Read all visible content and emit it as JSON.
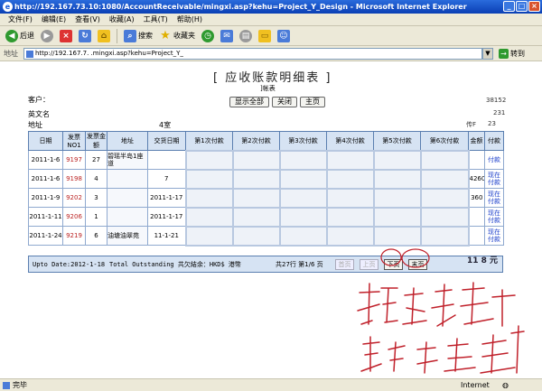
{
  "window": {
    "title": "http://192.167.73.10:1080/AccountReceivable/mingxi.asp?kehu=Project_Y_Design - Microsoft Internet Explorer",
    "controls": [
      "_",
      "□",
      "×"
    ]
  },
  "menu": [
    "文件(F)",
    "编辑(E)",
    "查看(V)",
    "收藏(A)",
    "工具(T)",
    "帮助(H)"
  ],
  "toolbar": {
    "back": "后退",
    "search": "搜索",
    "favorites": "收藏夹"
  },
  "address": {
    "label": "地址",
    "url": "http://192.167.7.                    .mingxi.asp?kehu=Project_Y_",
    "go": "转到"
  },
  "page": {
    "title": "[ 应收账款明细表 ]",
    "subtitle": "]帐表",
    "buttons": [
      "显示全部",
      "关闭",
      "主页"
    ],
    "customer_label": "客户：",
    "english_name_label": "英文名",
    "address_label": "地址",
    "address_tail": "4室",
    "right_val_1": "38152",
    "right_val_2": "231",
    "right_label_3": "传F",
    "right_val_3": "23"
  },
  "table": {
    "headers": [
      "日期",
      "发票NO1",
      "发票金额",
      "地址",
      "交货日期",
      "第1次付款",
      "第2次付款",
      "第3次付款",
      "第4次付款",
      "第5次付款",
      "第6次付款",
      "金额",
      "付款"
    ],
    "rows": [
      {
        "date": "2011-1-6",
        "inv": "9197",
        "amt": "27",
        "addr": "碧瑶半岛1座 道",
        "delivery": "",
        "amount": "",
        "pay": "付款"
      },
      {
        "date": "2011-1-6",
        "inv": "9198",
        "amt": "4",
        "addr": "",
        "delivery": "7",
        "amount": "4260",
        "pay": "现在 付款"
      },
      {
        "date": "2011-1-9",
        "inv": "9202",
        "amt": "3",
        "addr": "",
        "delivery": "2011-1-17",
        "amount": "360",
        "pay": "现在 付款"
      },
      {
        "date": "2011-1-11",
        "inv": "9206",
        "amt": "1",
        "addr": "",
        "delivery": "2011-1-17",
        "amount": "",
        "pay": "现在 付款"
      },
      {
        "date": "2011-1-24",
        "inv": "9219",
        "amt": "6",
        "addr": "油塘油翠苑",
        "delivery": "11-1-21",
        "amount": "",
        "pay": "现在 付款"
      }
    ]
  },
  "footer": {
    "upto": "Upto Date:2012-1-18",
    "total": "Total Outstanding 共欠結余：HKD$ 港幣",
    "count": "共27行  第1/6 页",
    "first": "首页",
    "prev": "上页",
    "next": "下页",
    "last": "末页",
    "sum": "11   8 元"
  },
  "status": {
    "text": "完毕",
    "zone": "Internet"
  }
}
